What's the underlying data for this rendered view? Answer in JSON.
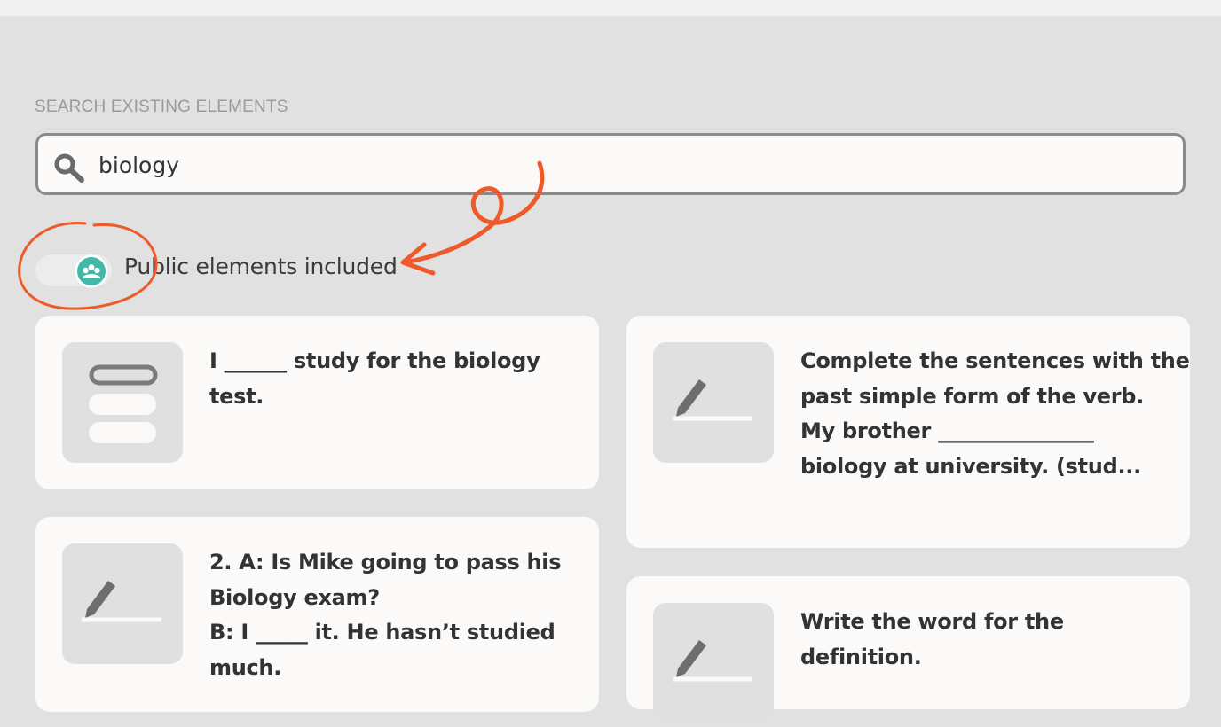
{
  "search": {
    "section_label": "SEARCH EXISTING ELEMENTS",
    "value": "biology",
    "icon": "search-icon"
  },
  "filter": {
    "label": "Public elements included",
    "enabled": true,
    "icon": "community-icon",
    "accent_color": "#3fbaa8",
    "annotation_color": "#ee5a2a"
  },
  "results": [
    {
      "type": "choice-icon",
      "lines": [
        "I ______ study for the biology",
        "test."
      ]
    },
    {
      "type": "pencil-icon",
      "lines": [
        "Complete the sentences with the",
        "past simple form of the verb.",
        "My brother _______________",
        "biology at university. (stud..."
      ]
    },
    {
      "type": "pencil-icon",
      "lines": [
        "2. A: Is Mike going to pass his",
        "Biology exam?",
        "B: I _____ it. He hasn’t studied",
        "much."
      ]
    },
    {
      "type": "pencil-icon",
      "lines": [
        "Write the word for the",
        "definition."
      ]
    }
  ]
}
